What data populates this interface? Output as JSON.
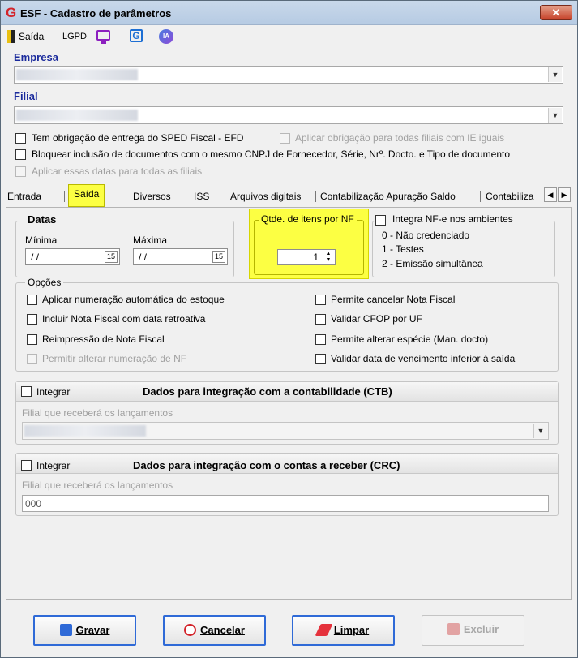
{
  "window": {
    "title": "ESF - Cadastro de parâmetros",
    "close": "✕"
  },
  "toolbar": {
    "exit": "Saída",
    "lgpd": "LGPD",
    "g_icon": "G",
    "ia_icon": "IA"
  },
  "empresa": {
    "label": "Empresa"
  },
  "filial": {
    "label": "Filial"
  },
  "options_top": {
    "sped": "Tem obrigação de entrega do SPED Fiscal - EFD",
    "apply_ie": "Aplicar obrigação para todas filiais com IE iguais",
    "block": "Bloquear inclusão de documentos com o mesmo CNPJ de Fornecedor, Série, Nrº. Docto. e Tipo de documento",
    "apply_dates": "Aplicar essas datas para todas as filiais"
  },
  "tabs": [
    "Entrada",
    "Saída",
    "Diversos",
    "ISS",
    "Arquivos digitais",
    "Contabilização Apuração Saldo",
    "Contabiliza"
  ],
  "tab_scroll": {
    "left": "◀",
    "right": "▶"
  },
  "datas": {
    "title": "Datas",
    "min_label": "Mínima",
    "max_label": "Máxima",
    "min_value": "/ /",
    "max_value": "/ /",
    "calendar": "15"
  },
  "qtde": {
    "label": "Qtde. de itens por NF",
    "value": "1",
    "up": "▲",
    "down": "▼"
  },
  "integra": {
    "label": "Integra NF-e nos ambientes",
    "opt0": "0 - Não credenciado",
    "opt1": "1 - Testes",
    "opt2": "2 - Emissão simultânea"
  },
  "opcoes": {
    "title": "Opções",
    "left": [
      "Aplicar numeração automática do estoque",
      "Incluir Nota Fiscal com data retroativa",
      "Reimpressão de Nota Fiscal",
      "Permitir alterar numeração de NF"
    ],
    "right": [
      "Permite cancelar Nota Fiscal",
      "Validar CFOP por UF",
      "Permite alterar espécie (Man. docto)",
      "Validar data de vencimento inferior à saída"
    ]
  },
  "ctb": {
    "integrar": "Integrar",
    "title": "Dados para integração com a contabilidade (CTB)",
    "filial_label": "Filial que receberá os lançamentos"
  },
  "crc": {
    "integrar": "Integrar",
    "title": "Dados para integração com o contas a receber (CRC)",
    "filial_label": "Filial que receberá os lançamentos",
    "filial_value": "000"
  },
  "buttons": {
    "gravar": "Gravar",
    "cancelar": "Cancelar",
    "limpar": "Limpar",
    "excluir": "Excluir"
  }
}
